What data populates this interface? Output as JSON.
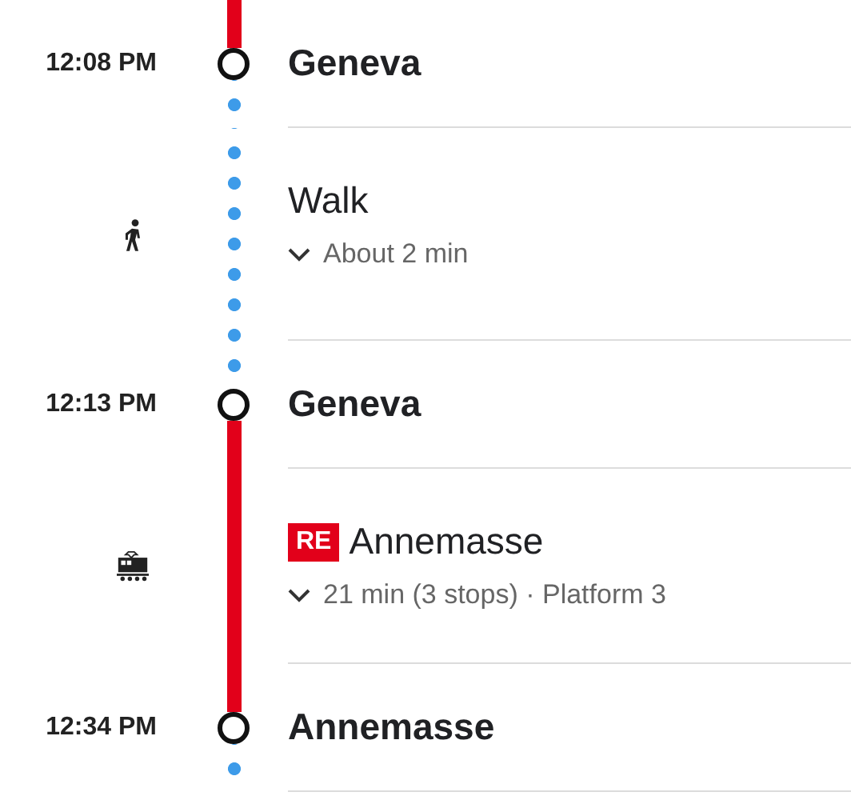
{
  "itinerary": [
    {
      "kind": "stop",
      "time": "12:08 PM",
      "name": "Geneva",
      "dotted_above": false,
      "dotted_below": true
    },
    {
      "kind": "walk",
      "title": "Walk",
      "detail": "About 2 min",
      "expanded": false
    },
    {
      "kind": "stop",
      "time": "12:13 PM",
      "name": "Geneva",
      "dotted_above": true,
      "dotted_below": false
    },
    {
      "kind": "transit",
      "badge": "RE",
      "title": "Annemasse",
      "detail": "21 min (3 stops) · Platform 3",
      "expanded": false
    },
    {
      "kind": "stop",
      "time": "12:34 PM",
      "name": "Annemasse",
      "dotted_above": false,
      "dotted_below": true
    }
  ]
}
